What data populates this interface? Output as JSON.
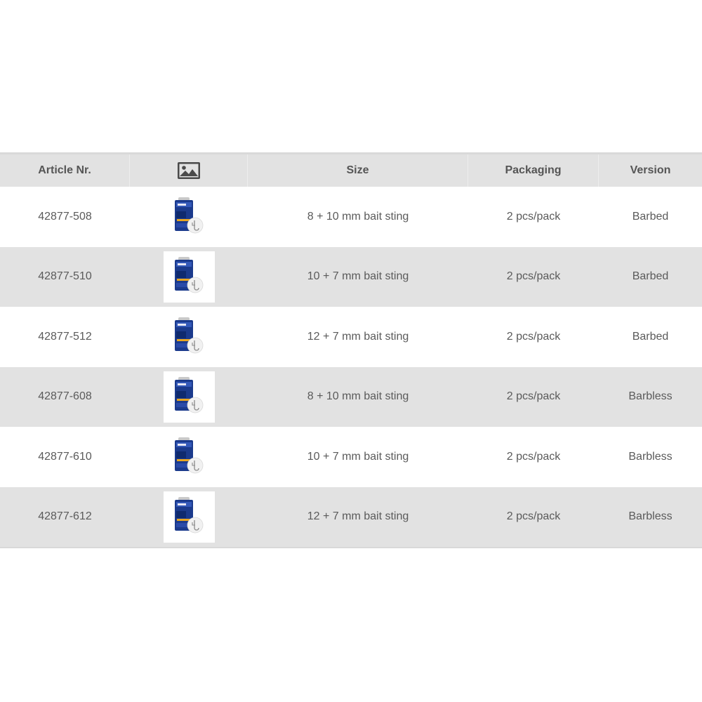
{
  "table": {
    "headers": {
      "article": "Article Nr.",
      "image_icon": "image-icon",
      "size": "Size",
      "packaging": "Packaging",
      "version": "Version"
    },
    "rows": [
      {
        "article": "42877-508",
        "thumbnail": "product-package-thumbnail",
        "size": "8 + 10 mm bait sting",
        "packaging": "2 pcs/pack",
        "version": "Barbed"
      },
      {
        "article": "42877-510",
        "thumbnail": "product-package-thumbnail",
        "size": "10 + 7 mm bait sting",
        "packaging": "2 pcs/pack",
        "version": "Barbed"
      },
      {
        "article": "42877-512",
        "thumbnail": "product-package-thumbnail",
        "size": "12 + 7 mm bait sting",
        "packaging": "2 pcs/pack",
        "version": "Barbed"
      },
      {
        "article": "42877-608",
        "thumbnail": "product-package-thumbnail",
        "size": "8 + 10 mm bait sting",
        "packaging": "2 pcs/pack",
        "version": "Barbless"
      },
      {
        "article": "42877-610",
        "thumbnail": "product-package-thumbnail",
        "size": "10 + 7 mm bait sting",
        "packaging": "2 pcs/pack",
        "version": "Barbless"
      },
      {
        "article": "42877-612",
        "thumbnail": "product-package-thumbnail",
        "size": "12 + 7 mm bait sting",
        "packaging": "2 pcs/pack",
        "version": "Barbless"
      }
    ]
  },
  "colors": {
    "header_bg": "#e2e2e2",
    "row_alt_bg": "#e2e2e2",
    "row_bg": "#ffffff",
    "text": "#555555",
    "package_blue": "#1b3a8c"
  }
}
